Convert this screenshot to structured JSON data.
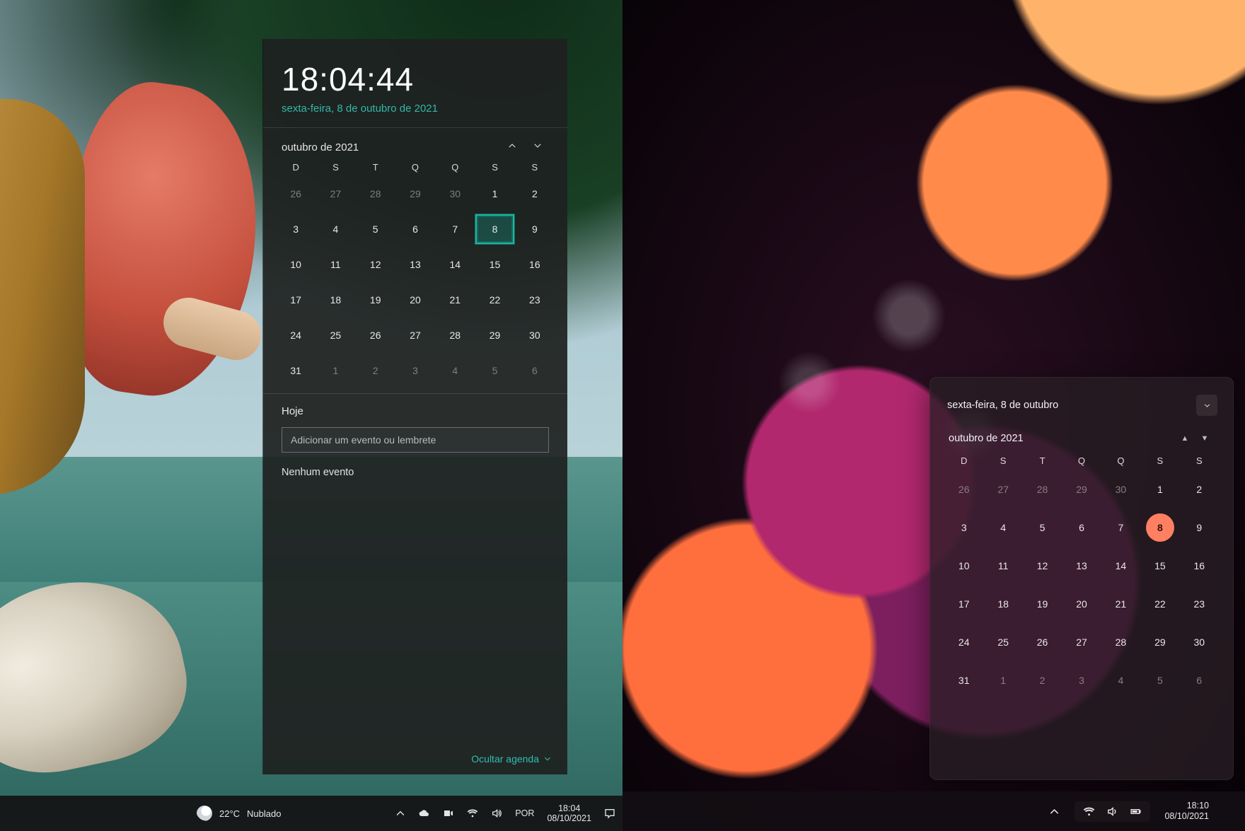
{
  "win10": {
    "time": "18:04:44",
    "date_full": "sexta-feira, 8 de outubro de 2021",
    "month_label": "outubro de 2021",
    "dow": [
      "D",
      "S",
      "T",
      "Q",
      "Q",
      "S",
      "S"
    ],
    "weeks": [
      [
        {
          "n": "26",
          "dim": true
        },
        {
          "n": "27",
          "dim": true
        },
        {
          "n": "28",
          "dim": true
        },
        {
          "n": "29",
          "dim": true
        },
        {
          "n": "30",
          "dim": true
        },
        {
          "n": "1"
        },
        {
          "n": "2"
        }
      ],
      [
        {
          "n": "3"
        },
        {
          "n": "4"
        },
        {
          "n": "5"
        },
        {
          "n": "6"
        },
        {
          "n": "7"
        },
        {
          "n": "8",
          "today": true
        },
        {
          "n": "9"
        }
      ],
      [
        {
          "n": "10"
        },
        {
          "n": "11"
        },
        {
          "n": "12"
        },
        {
          "n": "13"
        },
        {
          "n": "14"
        },
        {
          "n": "15"
        },
        {
          "n": "16"
        }
      ],
      [
        {
          "n": "17"
        },
        {
          "n": "18"
        },
        {
          "n": "19"
        },
        {
          "n": "20"
        },
        {
          "n": "21"
        },
        {
          "n": "22"
        },
        {
          "n": "23"
        }
      ],
      [
        {
          "n": "24"
        },
        {
          "n": "25"
        },
        {
          "n": "26"
        },
        {
          "n": "27"
        },
        {
          "n": "28"
        },
        {
          "n": "29"
        },
        {
          "n": "30"
        }
      ],
      [
        {
          "n": "31"
        },
        {
          "n": "1",
          "dim": true
        },
        {
          "n": "2",
          "dim": true
        },
        {
          "n": "3",
          "dim": true
        },
        {
          "n": "4",
          "dim": true
        },
        {
          "n": "5",
          "dim": true
        },
        {
          "n": "6",
          "dim": true
        }
      ]
    ],
    "agenda_heading": "Hoje",
    "event_placeholder": "Adicionar um evento ou lembrete",
    "no_events": "Nenhum evento",
    "hide_agenda": "Ocultar agenda",
    "taskbar": {
      "weather_temp": "22°C",
      "weather_desc": "Nublado",
      "lang": "POR",
      "time": "18:04",
      "date": "08/10/2021"
    }
  },
  "win11": {
    "date_full": "sexta-feira, 8 de outubro",
    "month_label": "outubro de 2021",
    "dow": [
      "D",
      "S",
      "T",
      "Q",
      "Q",
      "S",
      "S"
    ],
    "weeks": [
      [
        {
          "n": "26",
          "dim": true
        },
        {
          "n": "27",
          "dim": true
        },
        {
          "n": "28",
          "dim": true
        },
        {
          "n": "29",
          "dim": true
        },
        {
          "n": "30",
          "dim": true
        },
        {
          "n": "1"
        },
        {
          "n": "2"
        }
      ],
      [
        {
          "n": "3"
        },
        {
          "n": "4"
        },
        {
          "n": "5"
        },
        {
          "n": "6"
        },
        {
          "n": "7"
        },
        {
          "n": "8",
          "today": true
        },
        {
          "n": "9"
        }
      ],
      [
        {
          "n": "10"
        },
        {
          "n": "11"
        },
        {
          "n": "12"
        },
        {
          "n": "13"
        },
        {
          "n": "14"
        },
        {
          "n": "15"
        },
        {
          "n": "16"
        }
      ],
      [
        {
          "n": "17"
        },
        {
          "n": "18"
        },
        {
          "n": "19"
        },
        {
          "n": "20"
        },
        {
          "n": "21"
        },
        {
          "n": "22"
        },
        {
          "n": "23"
        }
      ],
      [
        {
          "n": "24"
        },
        {
          "n": "25"
        },
        {
          "n": "26"
        },
        {
          "n": "27"
        },
        {
          "n": "28"
        },
        {
          "n": "29"
        },
        {
          "n": "30"
        }
      ],
      [
        {
          "n": "31"
        },
        {
          "n": "1",
          "dim": true
        },
        {
          "n": "2",
          "dim": true
        },
        {
          "n": "3",
          "dim": true
        },
        {
          "n": "4",
          "dim": true
        },
        {
          "n": "5",
          "dim": true
        },
        {
          "n": "6",
          "dim": true
        }
      ]
    ],
    "taskbar": {
      "time": "18:10",
      "date": "08/10/2021"
    }
  }
}
